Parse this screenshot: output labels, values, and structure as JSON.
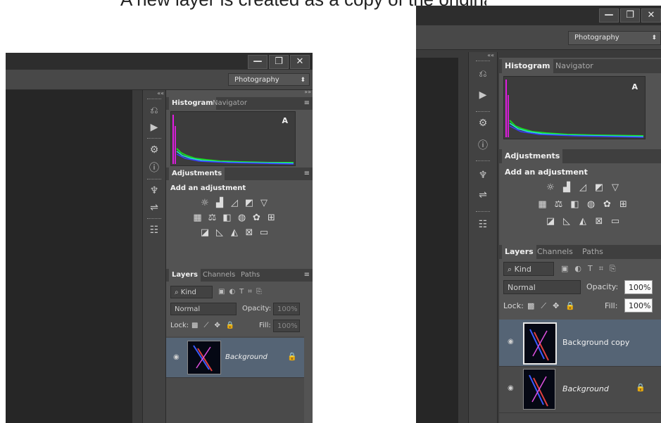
{
  "caption": "A new layer is created as a copy of the original image",
  "left": {
    "window_controls": [
      "—",
      "❐",
      "✕"
    ],
    "workspace": {
      "label": "Photography",
      "arrow": "⬍"
    },
    "collapse_left": "««",
    "collapse_right": "»»",
    "histogram_tab": "Histogram",
    "navigator_tab": "Navigator",
    "warning_glyph": "A",
    "adjustments_tab": "Adjustments",
    "add_adjustment": "Add an adjustment",
    "layers_tab": "Layers",
    "channels_tab": "Channels",
    "paths_tab": "Paths",
    "kind_filter": "⌕ Kind",
    "blend_mode": "Normal",
    "opacity_label": "Opacity:",
    "opacity_value": "100%",
    "lock_label": "Lock:",
    "fill_label": "Fill:",
    "fill_value": "100%",
    "layers": [
      {
        "name": "Background",
        "locked": true,
        "selected": true
      }
    ]
  },
  "right": {
    "window_controls": [
      "—",
      "❐",
      "✕"
    ],
    "workspace": {
      "label": "Photography",
      "arrow": "⬍"
    },
    "collapse_left": "««",
    "histogram_tab": "Histogram",
    "navigator_tab": "Navigator",
    "warning_glyph": "A",
    "adjustments_tab": "Adjustments",
    "add_adjustment": "Add an adjustment",
    "layers_tab": "Layers",
    "channels_tab": "Channels",
    "paths_tab": "Paths",
    "kind_filter": "⌕ Kind",
    "blend_mode": "Normal",
    "opacity_label": "Opacity:",
    "opacity_value": "100%",
    "lock_label": "Lock:",
    "fill_label": "Fill:",
    "fill_value": "100%",
    "layers": [
      {
        "name": "Background copy",
        "locked": false,
        "selected": true
      },
      {
        "name": "Background",
        "locked": true,
        "selected": false
      }
    ]
  },
  "icons": {
    "strip": [
      "history-icon",
      "actions-play-icon",
      "properties-icon",
      "info-icon",
      "brushes-icon",
      "clone-source-icon",
      "layer-comps-icon"
    ],
    "adjustments": [
      [
        "brightness-icon",
        "levels-icon",
        "curves-icon",
        "exposure-icon",
        "vibrance-icon"
      ],
      [
        "hue-saturation-icon",
        "color-balance-icon",
        "black-white-icon",
        "photo-filter-icon",
        "channel-mixer-icon",
        "color-lookup-icon"
      ],
      [
        "invert-icon",
        "posterize-icon",
        "threshold-icon",
        "selective-color-icon",
        "gradient-map-icon"
      ]
    ]
  },
  "colors": {
    "panel": "#535353",
    "selected_layer": "#556475",
    "canvas": "#262626"
  }
}
